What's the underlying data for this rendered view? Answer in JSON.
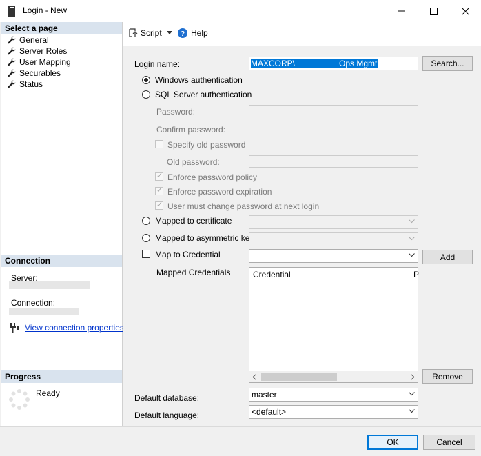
{
  "window": {
    "title": "Login - New"
  },
  "sidebar": {
    "select_page_header": "Select a page",
    "items": [
      {
        "label": "General"
      },
      {
        "label": "Server Roles"
      },
      {
        "label": "User Mapping"
      },
      {
        "label": "Securables"
      },
      {
        "label": "Status"
      }
    ],
    "connection_header": "Connection",
    "server_label": "Server:",
    "connection_label": "Connection:",
    "view_connection_link": "View connection properties",
    "progress_header": "Progress",
    "progress_status": "Ready"
  },
  "toolbar": {
    "script_label": "Script",
    "help_label": "Help"
  },
  "form": {
    "login_name_label": "Login name:",
    "login_name_value_prefix": "MAXCORP\\",
    "login_name_value_suffix": "Ops Mgmt",
    "search_button": "Search...",
    "windows_auth": "Windows authentication",
    "sql_auth": "SQL Server authentication",
    "password_label": "Password:",
    "confirm_password_label": "Confirm password:",
    "specify_old_password": "Specify old password",
    "old_password_label": "Old password:",
    "enforce_policy": "Enforce password policy",
    "enforce_expiration": "Enforce password expiration",
    "must_change": "User must change password at next login",
    "mapped_certificate": "Mapped to certificate",
    "mapped_asym_key": "Mapped to asymmetric key",
    "map_credential": "Map to Credential",
    "add_button": "Add",
    "mapped_credentials_label": "Mapped Credentials",
    "credential_col": "Credential",
    "provider_col_partial": "P",
    "remove_button": "Remove",
    "default_database_label": "Default database:",
    "default_database_value": "master",
    "default_language_label": "Default language:",
    "default_language_value": "<default>"
  },
  "footer": {
    "ok_button": "OK",
    "cancel_button": "Cancel"
  }
}
